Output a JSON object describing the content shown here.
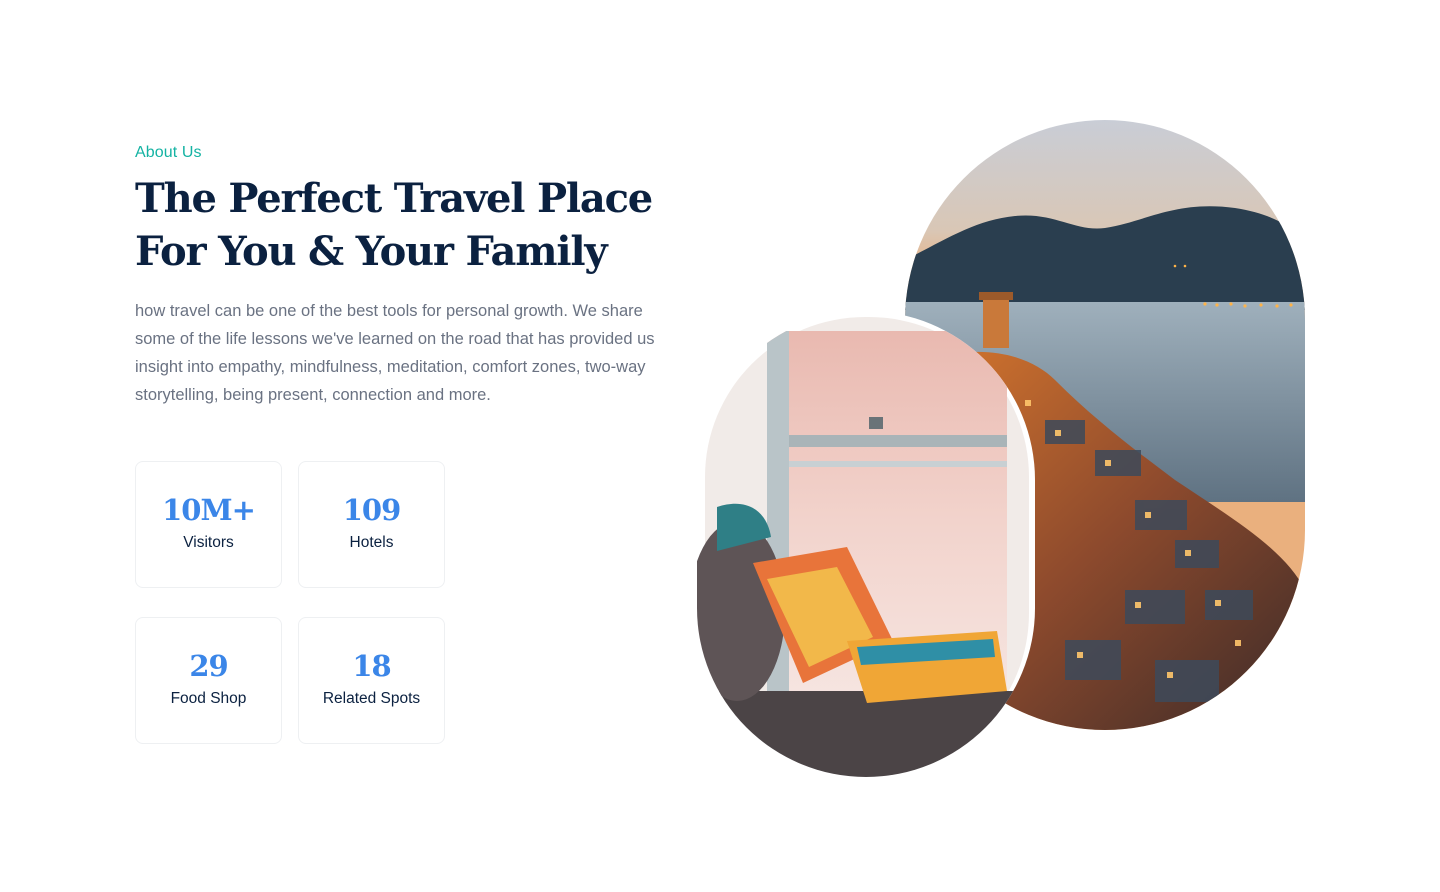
{
  "about": {
    "eyebrow": "About Us",
    "title": "The Perfect Travel Place For You & Your Family",
    "description": "how travel can be one of the best tools for personal growth. We share some of the life lessons we've learned on the road that has provided us insight into empathy, mindfulness, meditation, comfort zones, two-way storytelling, being present, connection and more."
  },
  "stats": [
    {
      "value": "10M+",
      "label": "Visitors"
    },
    {
      "value": "109",
      "label": "Hotels"
    },
    {
      "value": "29",
      "label": "Food Shop"
    },
    {
      "value": "18",
      "label": "Related Spots"
    }
  ],
  "colors": {
    "accent_teal": "#14b3a3",
    "heading_navy": "#0b2140",
    "stat_blue": "#3b86e8",
    "body_gray": "#6a7282"
  }
}
